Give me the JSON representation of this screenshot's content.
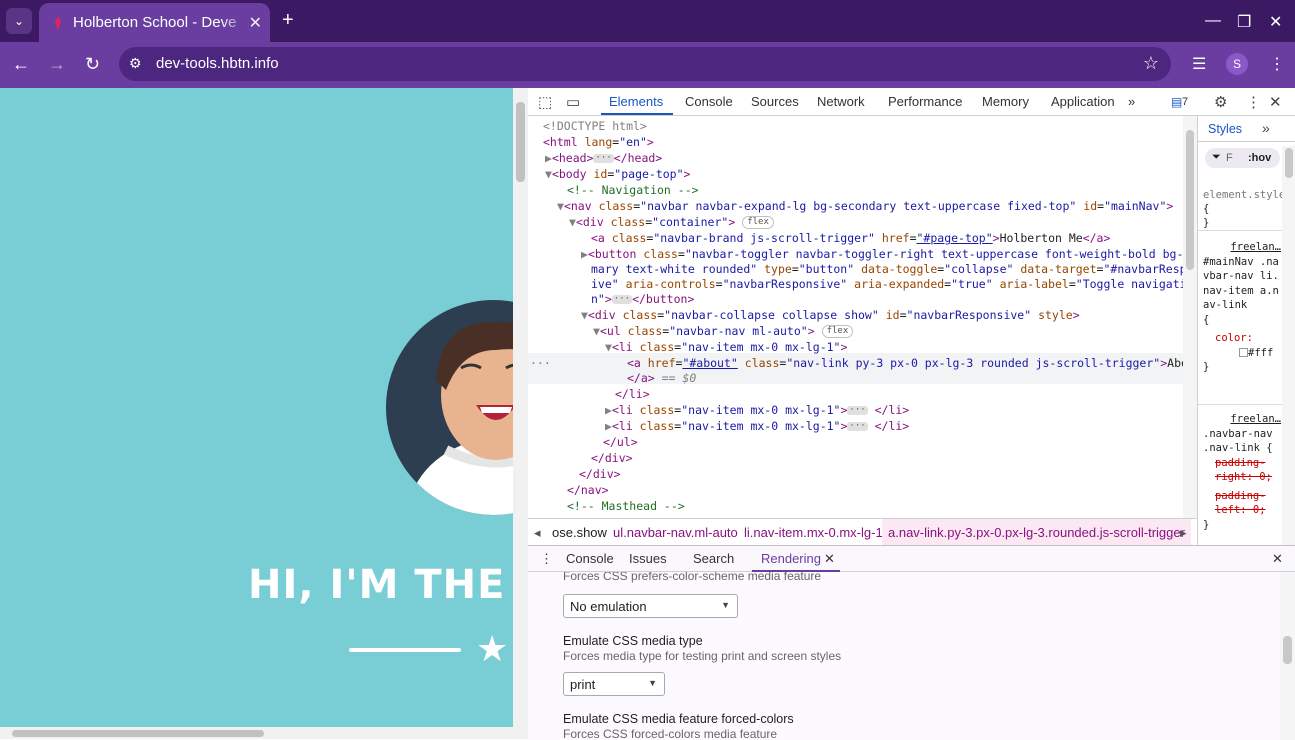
{
  "browser": {
    "tab_title": "Holberton School - Deve",
    "url": "dev-tools.hbtn.info",
    "profile_initial": "S"
  },
  "page": {
    "hero_text": "HI, I'M THE C"
  },
  "devtools": {
    "tabs": [
      "Elements",
      "Console",
      "Sources",
      "Network",
      "Performance",
      "Memory",
      "Application"
    ],
    "more": "»",
    "issues_count": "7",
    "elements": [
      {
        "html": "<span class='gray'>&lt;!DOCTYPE html&gt;</span>"
      }
    ],
    "breadcrumbs": [
      "ose.show",
      "ul.navbar-nav.ml-auto",
      "li.nav-item.mx-0.mx-lg-1",
      "a.nav-link.py-3.px-0.px-lg-3.rounded.js-scroll-trigger"
    ],
    "styles": {
      "tab": "Styles",
      "filter_icon": "filter-icon",
      "filter_text": "F",
      "hov": ":hov",
      "rule1_selector": "element.style",
      "rule1_body": "{",
      "rule1_end": "}",
      "rule2_source": "freelan…",
      "rule2_selector": "#mainNav .navbar-nav li.nav-item a.nav-link",
      "rule2_open": "{",
      "rule2_prop": "color:",
      "rule2_value": "#fff",
      "rule2_end": "}",
      "rule3_source": "freelan…",
      "rule3_selector": ".navbar-nav .nav-link {",
      "rule3_prop1": "padding-right: 0;",
      "rule3_prop2": "padding-left: 0;",
      "rule3_end": "}"
    },
    "drawer": {
      "tabs": [
        "Console",
        "Issues",
        "Search",
        "Rendering"
      ],
      "active_tab": "Rendering",
      "cut_desc": "Forces CSS prefers-color-scheme media feature",
      "select1_value": "No emulation",
      "media_type_title": "Emulate CSS media type",
      "media_type_desc": "Forces media type for testing print and screen styles",
      "select2_value": "print",
      "forced_colors_title": "Emulate CSS media feature forced-colors",
      "forced_colors_desc": "Forces CSS forced-colors media feature"
    }
  }
}
